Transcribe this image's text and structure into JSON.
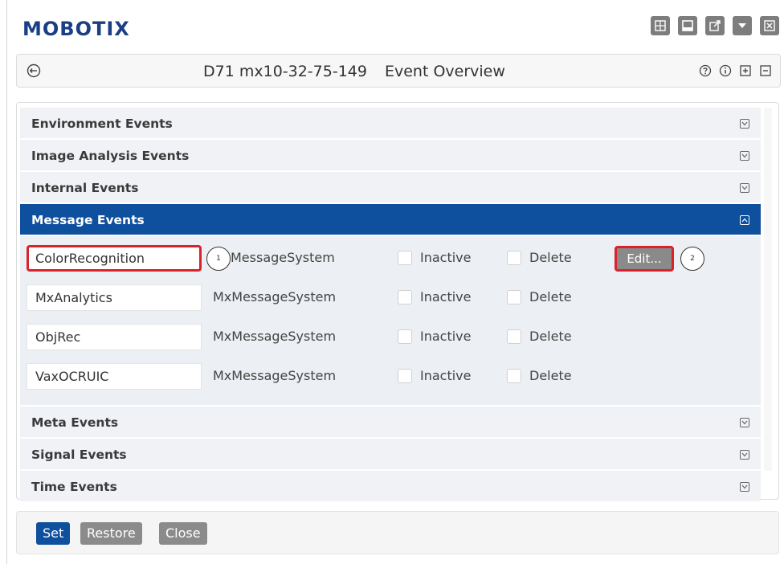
{
  "brand": "MOBOTIX",
  "top_icons": [
    "grid-icon",
    "window-icon",
    "external-link-icon",
    "dropdown-icon",
    "close-icon"
  ],
  "titlebar": {
    "camera": "D71 mx10-32-75-149",
    "page": "Event Overview",
    "icons": [
      "help-icon",
      "info-icon",
      "expand-all-icon",
      "collapse-all-icon"
    ]
  },
  "sections_before": [
    {
      "label": "Environment Events"
    },
    {
      "label": "Image Analysis Events"
    },
    {
      "label": "Internal Events"
    }
  ],
  "active_section": {
    "label": "Message Events"
  },
  "messages": [
    {
      "name": "ColorRecognition",
      "system": "MessageSystem",
      "inactive_label": "Inactive",
      "delete_label": "Delete",
      "edit_label": "Edit...",
      "callout_name": "1",
      "callout_edit": "2"
    },
    {
      "name": "MxAnalytics",
      "system": "MxMessageSystem",
      "inactive_label": "Inactive",
      "delete_label": "Delete"
    },
    {
      "name": "ObjRec",
      "system": "MxMessageSystem",
      "inactive_label": "Inactive",
      "delete_label": "Delete"
    },
    {
      "name": "VaxOCRUIC",
      "system": "MxMessageSystem",
      "inactive_label": "Inactive",
      "delete_label": "Delete"
    }
  ],
  "sections_after": [
    {
      "label": "Meta Events"
    },
    {
      "label": "Signal Events"
    },
    {
      "label": "Time Events"
    }
  ],
  "footer": {
    "set": "Set",
    "restore": "Restore",
    "close": "Close"
  },
  "colors": {
    "brand": "#1a3f86",
    "active_section": "#0e4f9e",
    "highlight": "#d9222a",
    "button_gray": "#8b8b8b"
  }
}
